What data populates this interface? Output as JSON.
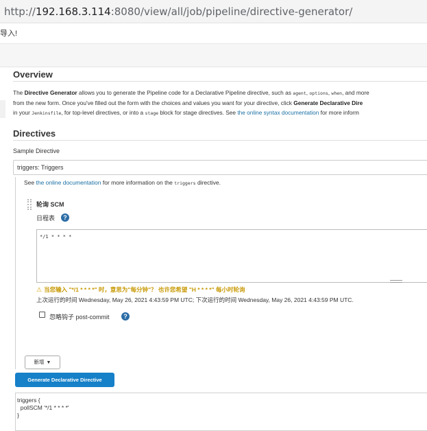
{
  "browser": {
    "url_scheme": "http://",
    "url_host": "192.168.3.114",
    "url_rest": ":8080/view/all/job/pipeline/directive-generator/"
  },
  "banner": {
    "text": "导入!"
  },
  "overview": {
    "title": "Overview",
    "line1_a": "The ",
    "line1_b": "Directive Generator",
    "line1_c": " allows you to generate the Pipeline code for a Declarative Pipeline directive, such as ",
    "code_agent": "agent",
    "comma1": ", ",
    "code_options": "options",
    "comma2": ", ",
    "code_when": "when",
    "line1_d": ", and more",
    "line2_a": "from the new form. Once you've filled out the form with the choices and values you want for your directive, click ",
    "line2_b": "Generate Declarative Dire",
    "line3_a": "in your ",
    "code_jenkinsfile": "Jenkinsfile",
    "line3_b": ", for top-level directives, or into a ",
    "code_stage": "stage",
    "line3_c": " block for stage directives. See ",
    "line3_link": "the online syntax documentation",
    "line3_d": " for more inform"
  },
  "directives": {
    "title": "Directives",
    "sample_label": "Sample Directive",
    "selected": "triggers: Triggers",
    "see_a": "See ",
    "see_link": "the online documentation",
    "see_b": " for more information on the ",
    "see_code": "triggers",
    "see_c": " directive.",
    "scm_title": "轮询 SCM",
    "schedule_label": "日程表",
    "schedule_value": "*/1 * * * *",
    "warning": "当您输入 \"*/1 * * * *\" 时，意思为\"每分钟\"？ 也许您希望 \"H * * * *\" 每小时轮询",
    "next_run": "上次运行的时间 Wednesday, May 26, 2021 4:43:59 PM UTC; 下次运行的时间 Wednesday, May 26, 2021 4:43:59 PM UTC.",
    "ignore_hook": "忽略钩子 post-commit",
    "add_label": "新增",
    "generate_label": "Generate Declarative Directive",
    "output": "triggers {\n  pollSCM '*/1 * * * *'\n}"
  },
  "icons": {
    "help": "help-icon",
    "warning": "warning-icon",
    "caret": "caret-down-icon",
    "drag": "drag-handle-icon"
  },
  "colors": {
    "link": "#1a6fa3",
    "primary_button": "#1680c8",
    "warning": "#c89a06",
    "help": "#2c6da6"
  }
}
